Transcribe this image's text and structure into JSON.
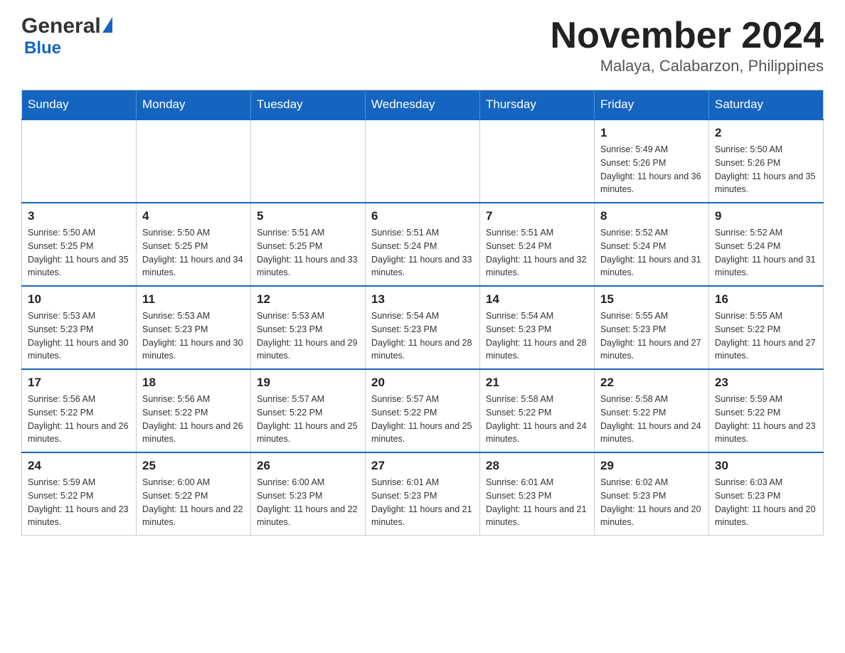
{
  "header": {
    "logo_general": "General",
    "logo_blue": "Blue",
    "main_title": "November 2024",
    "subtitle": "Malaya, Calabarzon, Philippines"
  },
  "days_of_week": [
    "Sunday",
    "Monday",
    "Tuesday",
    "Wednesday",
    "Thursday",
    "Friday",
    "Saturday"
  ],
  "weeks": [
    [
      {
        "day": "",
        "info": ""
      },
      {
        "day": "",
        "info": ""
      },
      {
        "day": "",
        "info": ""
      },
      {
        "day": "",
        "info": ""
      },
      {
        "day": "",
        "info": ""
      },
      {
        "day": "1",
        "info": "Sunrise: 5:49 AM\nSunset: 5:26 PM\nDaylight: 11 hours and 36 minutes."
      },
      {
        "day": "2",
        "info": "Sunrise: 5:50 AM\nSunset: 5:26 PM\nDaylight: 11 hours and 35 minutes."
      }
    ],
    [
      {
        "day": "3",
        "info": "Sunrise: 5:50 AM\nSunset: 5:25 PM\nDaylight: 11 hours and 35 minutes."
      },
      {
        "day": "4",
        "info": "Sunrise: 5:50 AM\nSunset: 5:25 PM\nDaylight: 11 hours and 34 minutes."
      },
      {
        "day": "5",
        "info": "Sunrise: 5:51 AM\nSunset: 5:25 PM\nDaylight: 11 hours and 33 minutes."
      },
      {
        "day": "6",
        "info": "Sunrise: 5:51 AM\nSunset: 5:24 PM\nDaylight: 11 hours and 33 minutes."
      },
      {
        "day": "7",
        "info": "Sunrise: 5:51 AM\nSunset: 5:24 PM\nDaylight: 11 hours and 32 minutes."
      },
      {
        "day": "8",
        "info": "Sunrise: 5:52 AM\nSunset: 5:24 PM\nDaylight: 11 hours and 31 minutes."
      },
      {
        "day": "9",
        "info": "Sunrise: 5:52 AM\nSunset: 5:24 PM\nDaylight: 11 hours and 31 minutes."
      }
    ],
    [
      {
        "day": "10",
        "info": "Sunrise: 5:53 AM\nSunset: 5:23 PM\nDaylight: 11 hours and 30 minutes."
      },
      {
        "day": "11",
        "info": "Sunrise: 5:53 AM\nSunset: 5:23 PM\nDaylight: 11 hours and 30 minutes."
      },
      {
        "day": "12",
        "info": "Sunrise: 5:53 AM\nSunset: 5:23 PM\nDaylight: 11 hours and 29 minutes."
      },
      {
        "day": "13",
        "info": "Sunrise: 5:54 AM\nSunset: 5:23 PM\nDaylight: 11 hours and 28 minutes."
      },
      {
        "day": "14",
        "info": "Sunrise: 5:54 AM\nSunset: 5:23 PM\nDaylight: 11 hours and 28 minutes."
      },
      {
        "day": "15",
        "info": "Sunrise: 5:55 AM\nSunset: 5:23 PM\nDaylight: 11 hours and 27 minutes."
      },
      {
        "day": "16",
        "info": "Sunrise: 5:55 AM\nSunset: 5:22 PM\nDaylight: 11 hours and 27 minutes."
      }
    ],
    [
      {
        "day": "17",
        "info": "Sunrise: 5:56 AM\nSunset: 5:22 PM\nDaylight: 11 hours and 26 minutes."
      },
      {
        "day": "18",
        "info": "Sunrise: 5:56 AM\nSunset: 5:22 PM\nDaylight: 11 hours and 26 minutes."
      },
      {
        "day": "19",
        "info": "Sunrise: 5:57 AM\nSunset: 5:22 PM\nDaylight: 11 hours and 25 minutes."
      },
      {
        "day": "20",
        "info": "Sunrise: 5:57 AM\nSunset: 5:22 PM\nDaylight: 11 hours and 25 minutes."
      },
      {
        "day": "21",
        "info": "Sunrise: 5:58 AM\nSunset: 5:22 PM\nDaylight: 11 hours and 24 minutes."
      },
      {
        "day": "22",
        "info": "Sunrise: 5:58 AM\nSunset: 5:22 PM\nDaylight: 11 hours and 24 minutes."
      },
      {
        "day": "23",
        "info": "Sunrise: 5:59 AM\nSunset: 5:22 PM\nDaylight: 11 hours and 23 minutes."
      }
    ],
    [
      {
        "day": "24",
        "info": "Sunrise: 5:59 AM\nSunset: 5:22 PM\nDaylight: 11 hours and 23 minutes."
      },
      {
        "day": "25",
        "info": "Sunrise: 6:00 AM\nSunset: 5:22 PM\nDaylight: 11 hours and 22 minutes."
      },
      {
        "day": "26",
        "info": "Sunrise: 6:00 AM\nSunset: 5:23 PM\nDaylight: 11 hours and 22 minutes."
      },
      {
        "day": "27",
        "info": "Sunrise: 6:01 AM\nSunset: 5:23 PM\nDaylight: 11 hours and 21 minutes."
      },
      {
        "day": "28",
        "info": "Sunrise: 6:01 AM\nSunset: 5:23 PM\nDaylight: 11 hours and 21 minutes."
      },
      {
        "day": "29",
        "info": "Sunrise: 6:02 AM\nSunset: 5:23 PM\nDaylight: 11 hours and 20 minutes."
      },
      {
        "day": "30",
        "info": "Sunrise: 6:03 AM\nSunset: 5:23 PM\nDaylight: 11 hours and 20 minutes."
      }
    ]
  ]
}
